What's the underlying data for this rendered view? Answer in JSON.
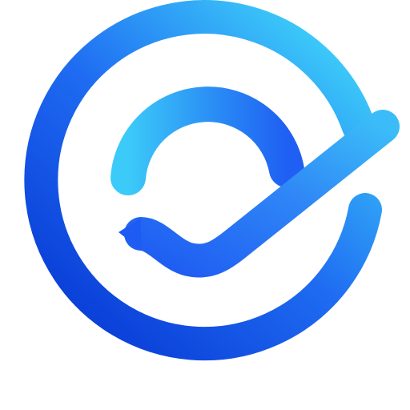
{
  "logo": {
    "icon": "circular-checkmark-logo-icon",
    "colors": {
      "background": "#ffffff",
      "deep_blue": "#0a3fd8",
      "mid_blue": "#1f6cf2",
      "bright_blue": "#2f86f6",
      "light_cyan": "#3ccaf9",
      "sky_blue": "#3aa6f1"
    }
  }
}
